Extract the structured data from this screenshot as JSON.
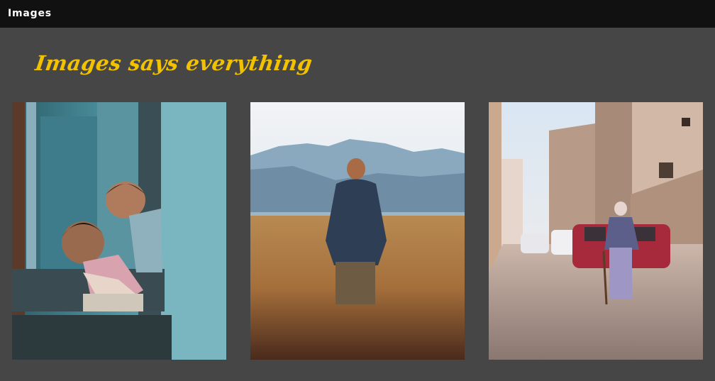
{
  "nav": {
    "brand": "Images"
  },
  "main": {
    "headline": "Images says everything",
    "accent_color": "#f2c200",
    "gallery": [
      {
        "subject": "children-peeking-photo"
      },
      {
        "subject": "man-in-wheat-field-photo"
      },
      {
        "subject": "old-man-walking-street-photo"
      }
    ]
  }
}
